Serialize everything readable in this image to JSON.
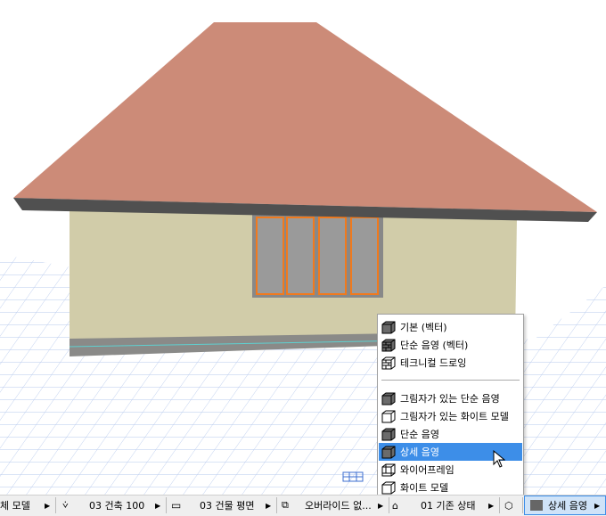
{
  "menu": {
    "items": [
      {
        "label": "기본 (벡터)",
        "icon": "block-solid-icon"
      },
      {
        "label": "단순 음영 (벡터)",
        "icon": "block-brick-dark-icon"
      },
      {
        "label": "테크니컬 드로잉",
        "icon": "block-brick-icon"
      },
      {
        "label": "그림자가 있는 단순 음영",
        "icon": "block-solid-icon"
      },
      {
        "label": "그림자가 있는 화이트 모델",
        "icon": "block-white-icon"
      },
      {
        "label": "단순 음영",
        "icon": "block-solid-icon"
      },
      {
        "label": "상세 음영",
        "icon": "block-solid-icon",
        "selected": true
      },
      {
        "label": "와이어프레임",
        "icon": "block-wire-icon"
      },
      {
        "label": "화이트 모델",
        "icon": "block-white-icon"
      }
    ]
  },
  "status": {
    "model": "체 모델",
    "layer": "03 건축 100",
    "view": "03 건물 평면",
    "override": "오버라이드 없...",
    "renovation": "01 기존 상태",
    "render": "상세 음영"
  },
  "colors": {
    "roof": "#cc8b78",
    "wall": "#d1cca9",
    "accent": "#3d8ee8",
    "window": "#f07a1e"
  }
}
